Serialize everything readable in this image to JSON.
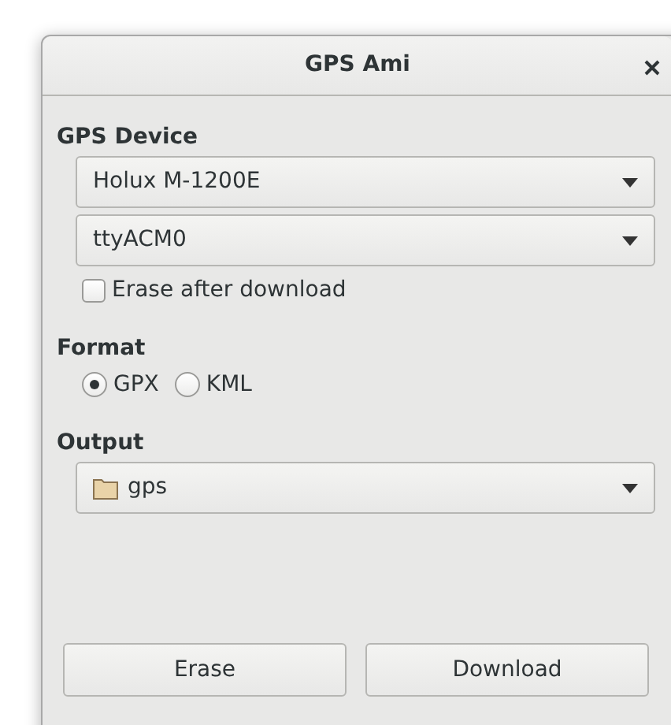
{
  "window": {
    "title": "GPS Ami"
  },
  "device": {
    "label": "GPS Device",
    "model": "Holux M-1200E",
    "port": "ttyACM0",
    "erase_after": {
      "label": "Erase after download",
      "checked": false
    }
  },
  "format": {
    "label": "Format",
    "options": [
      {
        "label": "GPX",
        "selected": true
      },
      {
        "label": "KML",
        "selected": false
      }
    ]
  },
  "output": {
    "label": "Output",
    "folder": "gps"
  },
  "buttons": [
    {
      "label": "Erase"
    },
    {
      "label": "Download"
    }
  ]
}
